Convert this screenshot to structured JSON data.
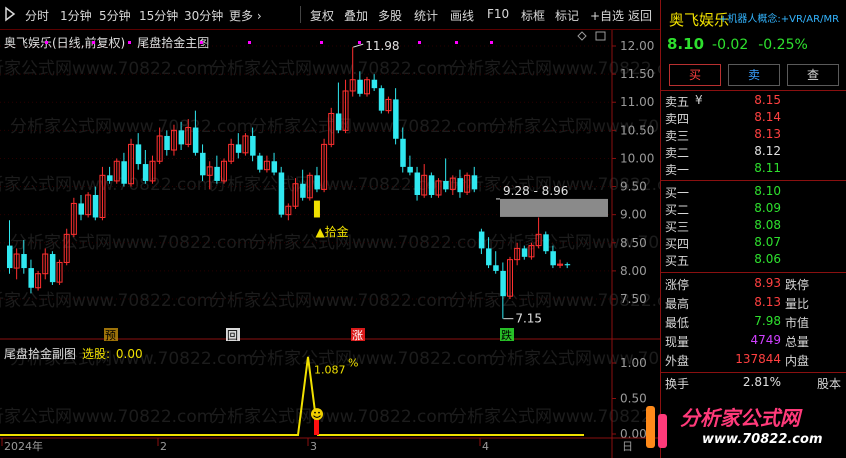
{
  "toolbar": {
    "items": [
      "分时",
      "1分钟",
      "5分钟",
      "15分钟",
      "30分钟",
      "更多",
      "复权",
      "叠加",
      "多股",
      "统计",
      "画线",
      "F10",
      "标框",
      "标记",
      "+自选",
      "返回"
    ],
    "more_arrow": "›"
  },
  "main_chart": {
    "title": "奥飞娱乐(日线,前复权)",
    "indicator": "尾盘拾金主图",
    "max_label": "11.98",
    "min_label": "7.15",
    "range_label": "9.28 - 8.96",
    "signal_label": "拾金",
    "signal_marker": "▲",
    "markers": [
      "预",
      "回",
      "涨",
      "跌"
    ],
    "y_ticks": [
      "12.00",
      "11.50",
      "11.00",
      "10.50",
      "10.00",
      "9.50",
      "9.00",
      "8.50",
      "8.00",
      "7.50"
    ],
    "watermark_text": "分析家公式网www.70822.com",
    "colors": {
      "up": "#ff3030",
      "down": "#30e8f0",
      "flat": "#ffffff",
      "marker_dots": "#ff00ff"
    }
  },
  "sub_chart": {
    "title": "尾盘拾金副图",
    "selected_label": "选股:",
    "selected_value": "0.00",
    "peak_label": "1.087",
    "peak_unit": "%",
    "y_ticks": [
      "1.00",
      "0.50",
      "0.00"
    ]
  },
  "x_axis": {
    "labels": [
      "2024年",
      "2",
      "3",
      "4"
    ],
    "corner": "日"
  },
  "right_panel": {
    "stock_name": "奥飞娱乐",
    "concepts": "+机器人概念:+VR/AR/MR",
    "price": "8.10",
    "change": "-0.02",
    "change_pct": "-0.25%",
    "buttons": {
      "buy": "买",
      "sell": "卖",
      "query": "查"
    },
    "asks": [
      {
        "label": "卖五",
        "price": "8.15",
        "color": "#ff4040"
      },
      {
        "label": "卖四",
        "price": "8.14",
        "color": "#ff4040"
      },
      {
        "label": "卖三",
        "price": "8.13",
        "color": "#ff4040"
      },
      {
        "label": "卖二",
        "price": "8.12",
        "color": "#e0e0e0"
      },
      {
        "label": "卖一",
        "price": "8.11",
        "color": "#2ee02e"
      }
    ],
    "ask_currency": "¥",
    "bids": [
      {
        "label": "买一",
        "price": "8.10",
        "color": "#2ee02e"
      },
      {
        "label": "买二",
        "price": "8.09",
        "color": "#2ee02e"
      },
      {
        "label": "买三",
        "price": "8.08",
        "color": "#2ee02e"
      },
      {
        "label": "买四",
        "price": "8.07",
        "color": "#2ee02e"
      },
      {
        "label": "买五",
        "price": "8.06",
        "color": "#2ee02e"
      }
    ],
    "stats": [
      {
        "k": "涨停",
        "v": "8.93",
        "vc": "#ff4040",
        "k2": "跌停"
      },
      {
        "k": "最高",
        "v": "8.13",
        "vc": "#ff4040",
        "k2": "量比"
      },
      {
        "k": "最低",
        "v": "7.98",
        "vc": "#2ee02e",
        "k2": "市值"
      },
      {
        "k": "现量",
        "v": "4749",
        "vc": "#d040ff",
        "k2": "总量"
      },
      {
        "k": "外盘",
        "v": "137844",
        "vc": "#ff4040",
        "k2": "内盘"
      }
    ],
    "turnover": {
      "k": "换手",
      "v": "2.81%",
      "k2": "股本"
    },
    "brand": {
      "line1": "分析家公式网",
      "line2": "www.70822.com"
    }
  }
}
